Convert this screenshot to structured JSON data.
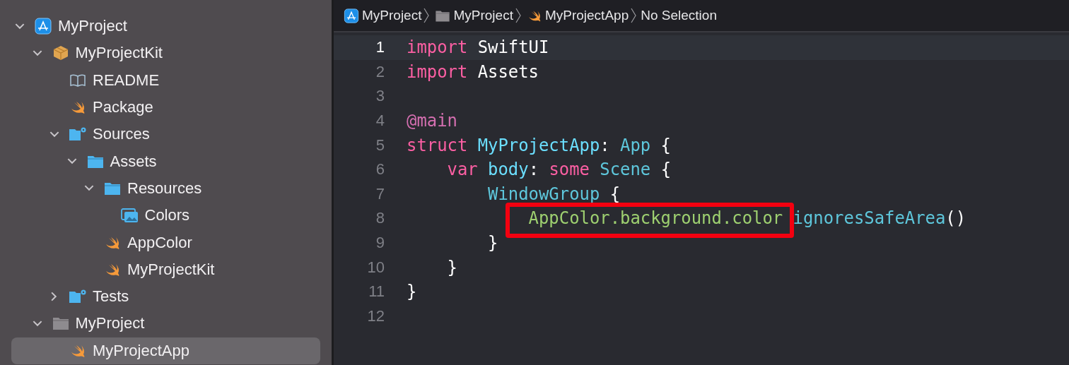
{
  "navigator": {
    "items": [
      {
        "label": "MyProject",
        "kind": "project",
        "expanded": true,
        "selected": false,
        "children": [
          {
            "label": "MyProjectKit",
            "kind": "package",
            "expanded": true,
            "selected": false,
            "children": [
              {
                "label": "README",
                "kind": "book",
                "selected": false
              },
              {
                "label": "Package",
                "kind": "swift",
                "selected": false
              },
              {
                "label": "Sources",
                "kind": "folder-gear",
                "expanded": true,
                "selected": false,
                "children": [
                  {
                    "label": "Assets",
                    "kind": "folder",
                    "expanded": true,
                    "selected": false,
                    "children": [
                      {
                        "label": "Resources",
                        "kind": "folder",
                        "expanded": true,
                        "selected": false,
                        "children": [
                          {
                            "label": "Colors",
                            "kind": "assets",
                            "selected": false
                          }
                        ]
                      },
                      {
                        "label": "AppColor",
                        "kind": "swift",
                        "selected": false
                      },
                      {
                        "label": "MyProjectKit",
                        "kind": "swift",
                        "selected": false
                      }
                    ]
                  }
                ]
              },
              {
                "label": "Tests",
                "kind": "folder-gear",
                "expanded": false,
                "selected": false
              }
            ]
          },
          {
            "label": "MyProject",
            "kind": "folder-gray",
            "expanded": true,
            "selected": false,
            "children": [
              {
                "label": "MyProjectApp",
                "kind": "swift",
                "selected": true
              }
            ]
          }
        ]
      }
    ]
  },
  "breadcrumb": [
    {
      "label": "MyProject",
      "kind": "project"
    },
    {
      "label": "MyProject",
      "kind": "folder-gray"
    },
    {
      "label": "MyProjectApp",
      "kind": "swift"
    },
    {
      "label": "No Selection",
      "kind": "plain"
    }
  ],
  "editor": {
    "lines": [
      {
        "number": "1",
        "current": true,
        "annotated": false,
        "tokens": [
          {
            "text": "import",
            "kind": "keyword"
          },
          {
            "text": " SwiftUI",
            "kind": "plain"
          }
        ]
      },
      {
        "number": "2",
        "current": false,
        "annotated": false,
        "tokens": [
          {
            "text": "import",
            "kind": "keyword"
          },
          {
            "text": " Assets",
            "kind": "plain"
          }
        ]
      },
      {
        "number": "3",
        "current": false,
        "annotated": false
      },
      {
        "number": "4",
        "current": false,
        "annotated": false,
        "tokens": [
          {
            "text": "@main",
            "kind": "attribute"
          }
        ]
      },
      {
        "number": "5",
        "current": false,
        "annotated": false,
        "tokens": [
          {
            "text": "struct ",
            "kind": "keyword"
          },
          {
            "text": "MyProjectApp",
            "kind": "declaration"
          },
          {
            "text": ": ",
            "kind": "plain"
          },
          {
            "text": "App",
            "kind": "type"
          },
          {
            "text": " {",
            "kind": "plain"
          }
        ]
      },
      {
        "number": "6",
        "current": false,
        "annotated": false,
        "tokens": [
          {
            "text": "    var ",
            "kind": "keyword"
          },
          {
            "text": "body",
            "kind": "declaration"
          },
          {
            "text": ": ",
            "kind": "plain"
          },
          {
            "text": "some ",
            "kind": "keyword"
          },
          {
            "text": "Scene",
            "kind": "type"
          },
          {
            "text": " {",
            "kind": "plain"
          }
        ]
      },
      {
        "number": "7",
        "current": false,
        "annotated": false,
        "tokens": [
          {
            "text": "        WindowGroup",
            "kind": "type"
          },
          {
            "text": " {",
            "kind": "plain"
          }
        ]
      },
      {
        "number": "8",
        "current": false,
        "annotated": true,
        "tokens": [
          {
            "text": "            AppColor.background.color ",
            "kind": "project"
          },
          {
            "text": "ignoresSafeArea",
            "kind": "type"
          },
          {
            "text": "()",
            "kind": "plain"
          }
        ]
      },
      {
        "number": "9",
        "current": false,
        "annotated": false,
        "tokens": [
          {
            "text": "        }",
            "kind": "plain"
          }
        ]
      },
      {
        "number": "10",
        "current": false,
        "annotated": false,
        "tokens": [
          {
            "text": "    }",
            "kind": "plain"
          }
        ]
      },
      {
        "number": "11",
        "current": false,
        "annotated": false,
        "tokens": [
          {
            "text": "}",
            "kind": "plain"
          }
        ]
      },
      {
        "number": "12",
        "current": false,
        "annotated": false
      }
    ]
  }
}
